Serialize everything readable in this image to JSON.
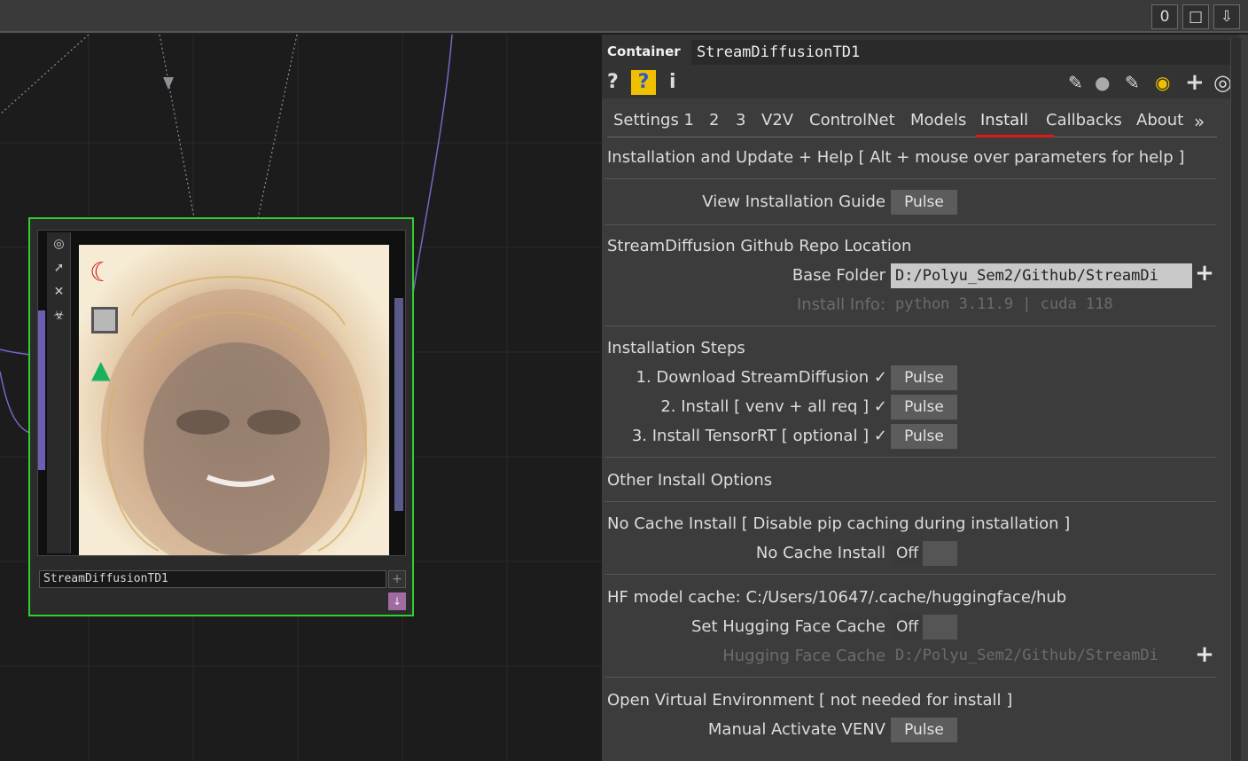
{
  "topbar": {
    "counter": "0"
  },
  "node": {
    "name": "StreamDiffusionTD1"
  },
  "panel": {
    "op_type": "Container",
    "op_name": "StreamDiffusionTD1",
    "tabs": [
      "Settings 1",
      "2",
      "3",
      "V2V",
      "ControlNet",
      "Models",
      "Install",
      "Callbacks",
      "About"
    ],
    "active_tab": "Install",
    "header_help": "Installation and Update + Help [ Alt + mouse over parameters for help ]",
    "view_guide_label": "View Installation Guide",
    "pulse": "Pulse",
    "repo_header": "StreamDiffusion Github Repo Location",
    "base_folder_label": "Base Folder",
    "base_folder_value": "D:/Polyu_Sem2/Github/StreamDi",
    "install_info_label": "Install Info:",
    "install_info_value": "python 3.11.9 | cuda 118",
    "steps_header": "Installation Steps",
    "step1": "1. Download StreamDiffusion ✓",
    "step2": "2. Install [ venv + all req ] ✓",
    "step3": "3. Install TensorRT [ optional ] ✓",
    "other_header": "Other Install Options",
    "nocache_header": "No Cache Install [ Disable pip caching during installation ]",
    "nocache_label": "No Cache Install",
    "off": "Off",
    "hf_header": "HF model cache: C:/Users/10647/.cache/huggingface/hub",
    "set_hf_label": "Set Hugging Face Cache",
    "hf_cache_label": "Hugging Face Cache",
    "hf_cache_value": "D:/Polyu_Sem2/Github/StreamDi",
    "venv_header": "Open Virtual Environment [ not needed for install ]",
    "venv_label": "Manual Activate VENV"
  },
  "colors": {
    "accent_underline": "#e01818",
    "node_border": "#2fcf2f"
  }
}
